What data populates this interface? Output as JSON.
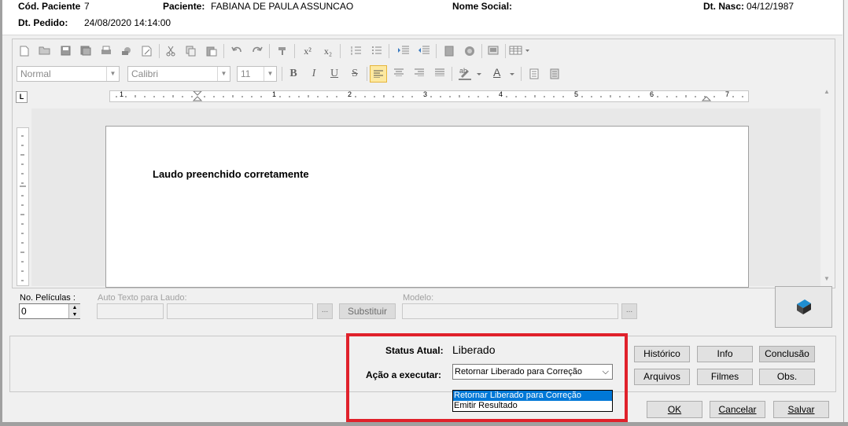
{
  "header": {
    "cod_paciente_label": "Cód. Paciente",
    "cod_paciente_value": "7",
    "paciente_label": "Paciente:",
    "paciente_value": "FABIANA DE PAULA ASSUNCAO",
    "nome_social_label": "Nome Social:",
    "dt_nasc_label": "Dt. Nasc:",
    "dt_nasc_value": "04/12/1987",
    "dt_pedido_label": "Dt. Pedido:",
    "dt_pedido_value": "24/08/2020 14:14:00"
  },
  "toolbar": {
    "style_value": "Normal",
    "font_value": "Calibri",
    "size_value": "11",
    "superscript": "x²",
    "subscript": "x₂",
    "bold": "B",
    "italic": "I",
    "underline": "U",
    "strike": "S",
    "font_color": "A",
    "highlight": "ab"
  },
  "ruler": {
    "corner": "L",
    "marks": [
      "1",
      "1",
      "2",
      "3",
      "4",
      "5",
      "6",
      "7"
    ]
  },
  "document": {
    "text": "Laudo preenchido corretamente"
  },
  "controls": {
    "peliculas_label": "No. Películas :",
    "peliculas_value": "0",
    "auto_texto_label": "Auto Texto para Laudo:",
    "ellipsis": "...",
    "substituir_label": "Substituir",
    "modelo_label": "Modelo:"
  },
  "status": {
    "status_label": "Status Atual:",
    "status_value": "Liberado",
    "acao_label": "Ação a executar:",
    "acao_selected": "Retornar Liberado para Correção",
    "acao_options": [
      "Retornar Liberado para Correção",
      "Emitir Resultado"
    ]
  },
  "side_buttons": {
    "historico": "Histórico",
    "info": "Info",
    "conclusao": "Conclusão",
    "arquivos": "Arquivos",
    "filmes": "Filmes",
    "obs": "Obs."
  },
  "footer": {
    "ok": "OK",
    "cancelar": "Cancelar",
    "salvar": "Salvar"
  },
  "colors": {
    "highlight_box": "#e0212b",
    "selection": "#0078d7"
  }
}
